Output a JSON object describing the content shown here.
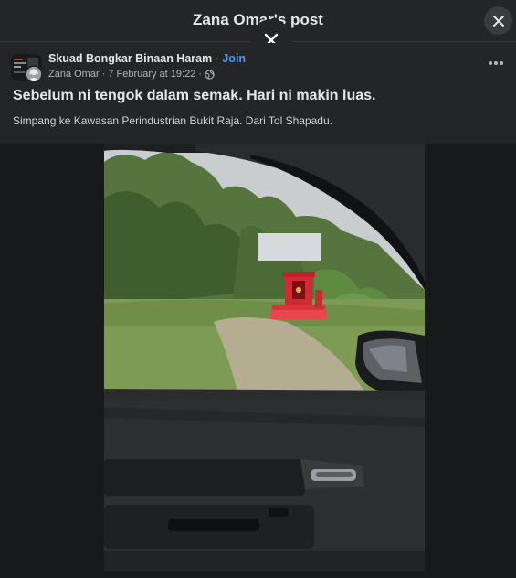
{
  "header": {
    "title": "Zana Omar's post",
    "close_icon": "close-icon",
    "overlay_close_icon": "close-icon"
  },
  "post": {
    "group_name": "Skuad Bongkar Binaan Haram",
    "separator": "·",
    "join_label": "Join",
    "author": "Zana Omar",
    "date": "7 February at 19:22",
    "meta_separator": "·",
    "audience_icon": "globe-icon",
    "more_icon": "more-options-icon",
    "title": "Sebelum ni tengok dalam semak. Hari ni makin luas.",
    "subtitle": "Simpang ke Kawasan Perindustrian Bukit Raja. Dari Tol Shapadu."
  },
  "photo": {
    "scene": "photo-car-window-view-shrine"
  },
  "colors": {
    "background": "#242526",
    "media_background": "#18191a",
    "link": "#4599ff",
    "text_primary": "#e4e6eb",
    "text_secondary": "#b0b3b8"
  }
}
